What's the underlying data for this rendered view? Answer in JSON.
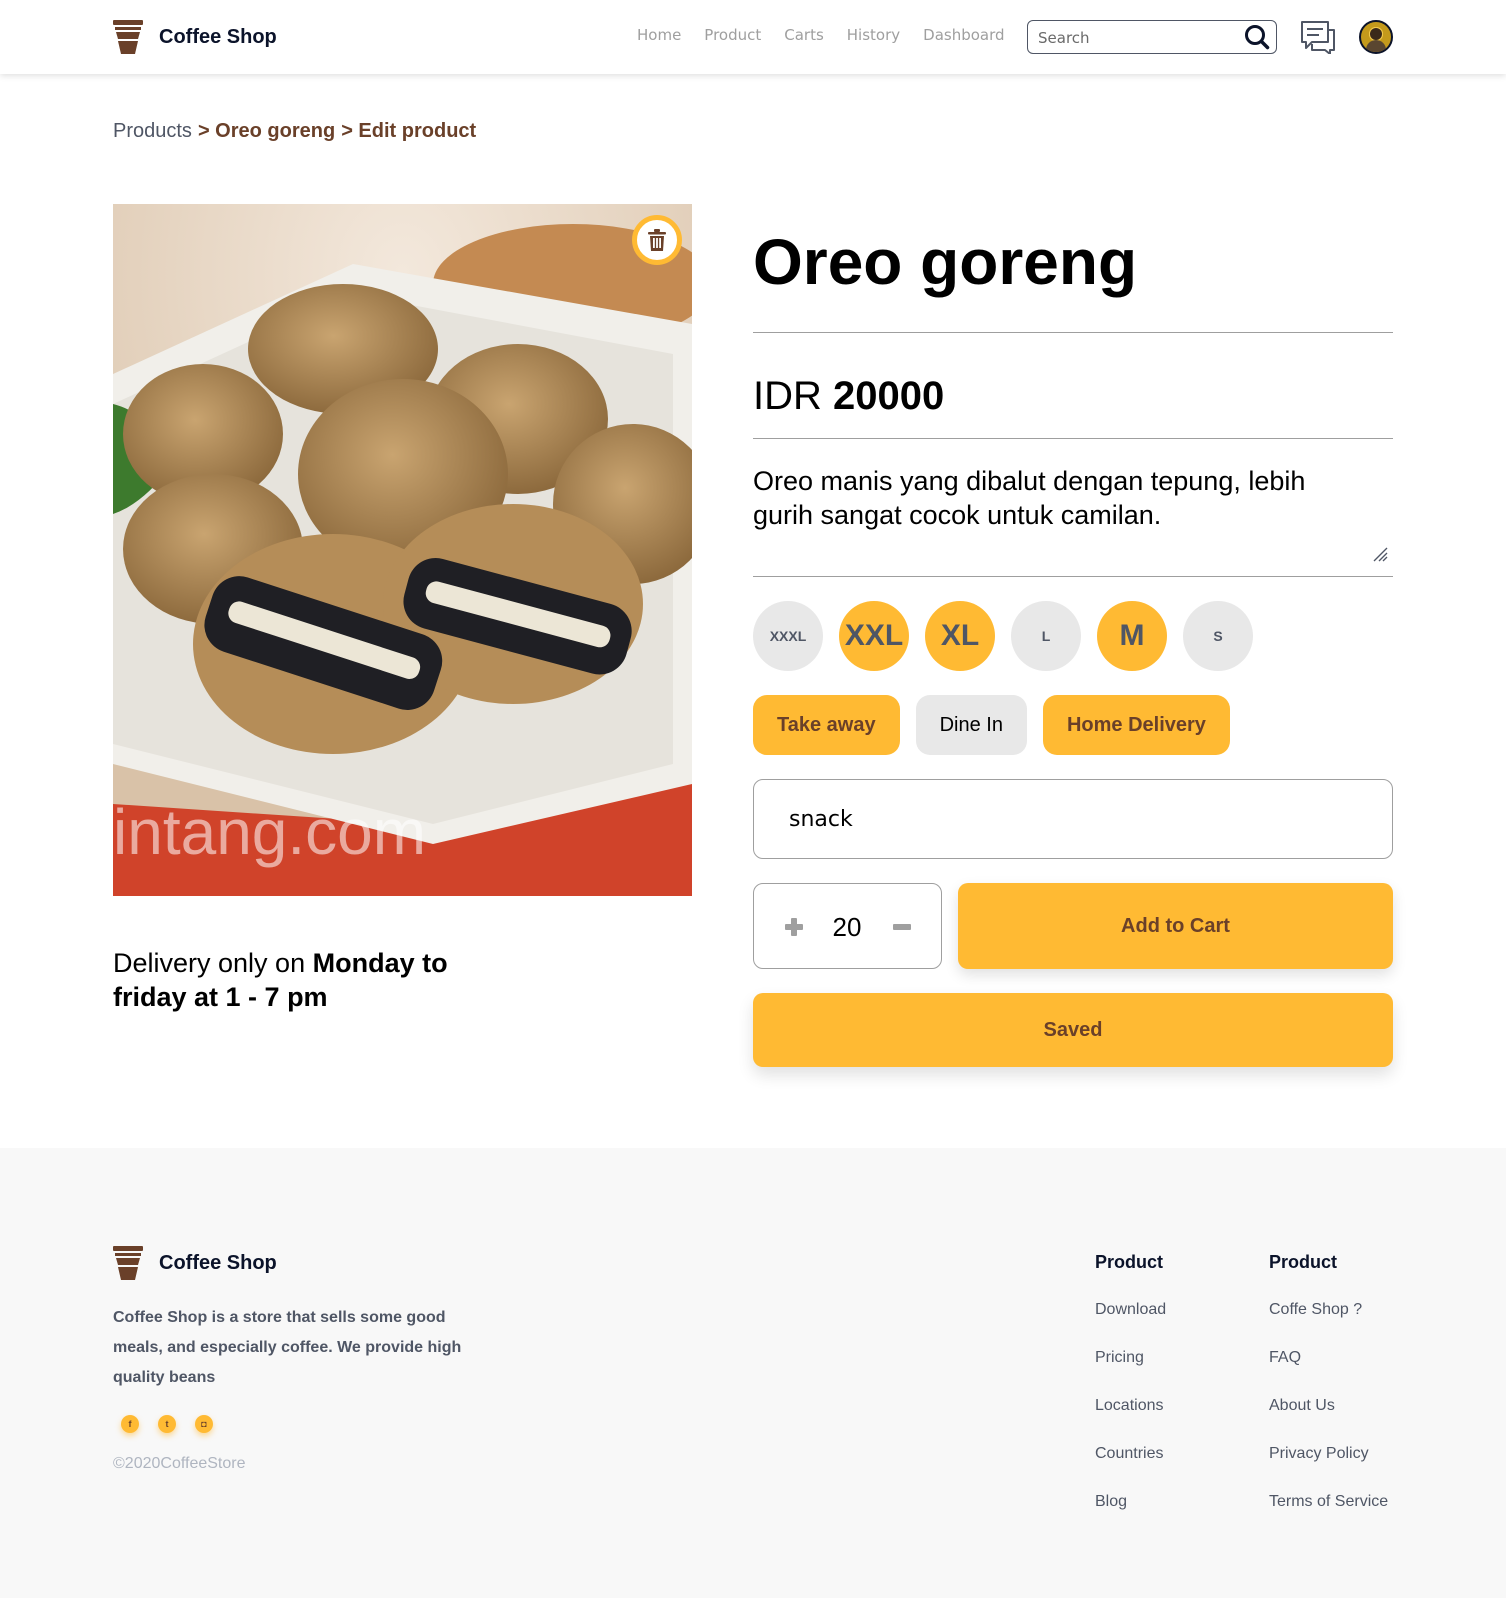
{
  "header": {
    "brand": "Coffee Shop",
    "nav": [
      "Home",
      "Product",
      "Carts",
      "History",
      "Dashboard"
    ],
    "search_placeholder": "Search"
  },
  "breadcrumb": {
    "root": "Products",
    "product": "> Oreo goreng",
    "current": "> Edit product"
  },
  "product": {
    "name": "Oreo goreng",
    "price_currency": "IDR",
    "price_value": "20000",
    "description": "Oreo manis yang dibalut dengan tepung, lebih gurih sangat cocok untuk camilan.",
    "image_watermark": "intang.com",
    "delivery_prefix": "Delivery only on ",
    "delivery_bold": "Monday to friday at 1 - 7 pm",
    "sizes": [
      {
        "label": "XXXL",
        "selected": false
      },
      {
        "label": "XXL",
        "selected": true
      },
      {
        "label": "XL",
        "selected": true
      },
      {
        "label": "L",
        "selected": false
      },
      {
        "label": "M",
        "selected": true
      },
      {
        "label": "S",
        "selected": false
      }
    ],
    "delivery_methods": [
      {
        "label": "Take away",
        "selected": true
      },
      {
        "label": "Dine In",
        "selected": false
      },
      {
        "label": "Home Delivery",
        "selected": true
      }
    ],
    "category": "snack",
    "quantity": "20",
    "add_to_cart_label": "Add to Cart",
    "save_label": "Saved"
  },
  "colors": {
    "accent": "#ffba33",
    "brown": "#6a4029",
    "muted": "#e8e8e8"
  },
  "footer": {
    "brand": "Coffee Shop",
    "description": "Coffee Shop is a store that sells some good meals, and especially coffee. We provide high quality beans",
    "socials": [
      "facebook-icon",
      "twitter-icon",
      "instagram-icon"
    ],
    "copyright": "©2020CoffeeStore",
    "columns": [
      {
        "heading": "Product",
        "links": [
          "Download",
          "Pricing",
          "Locations",
          "Countries",
          "Blog"
        ]
      },
      {
        "heading": "Product",
        "links": [
          "Coffe Shop ?",
          "FAQ",
          "About Us",
          "Privacy Policy",
          "Terms of Service"
        ]
      }
    ]
  }
}
